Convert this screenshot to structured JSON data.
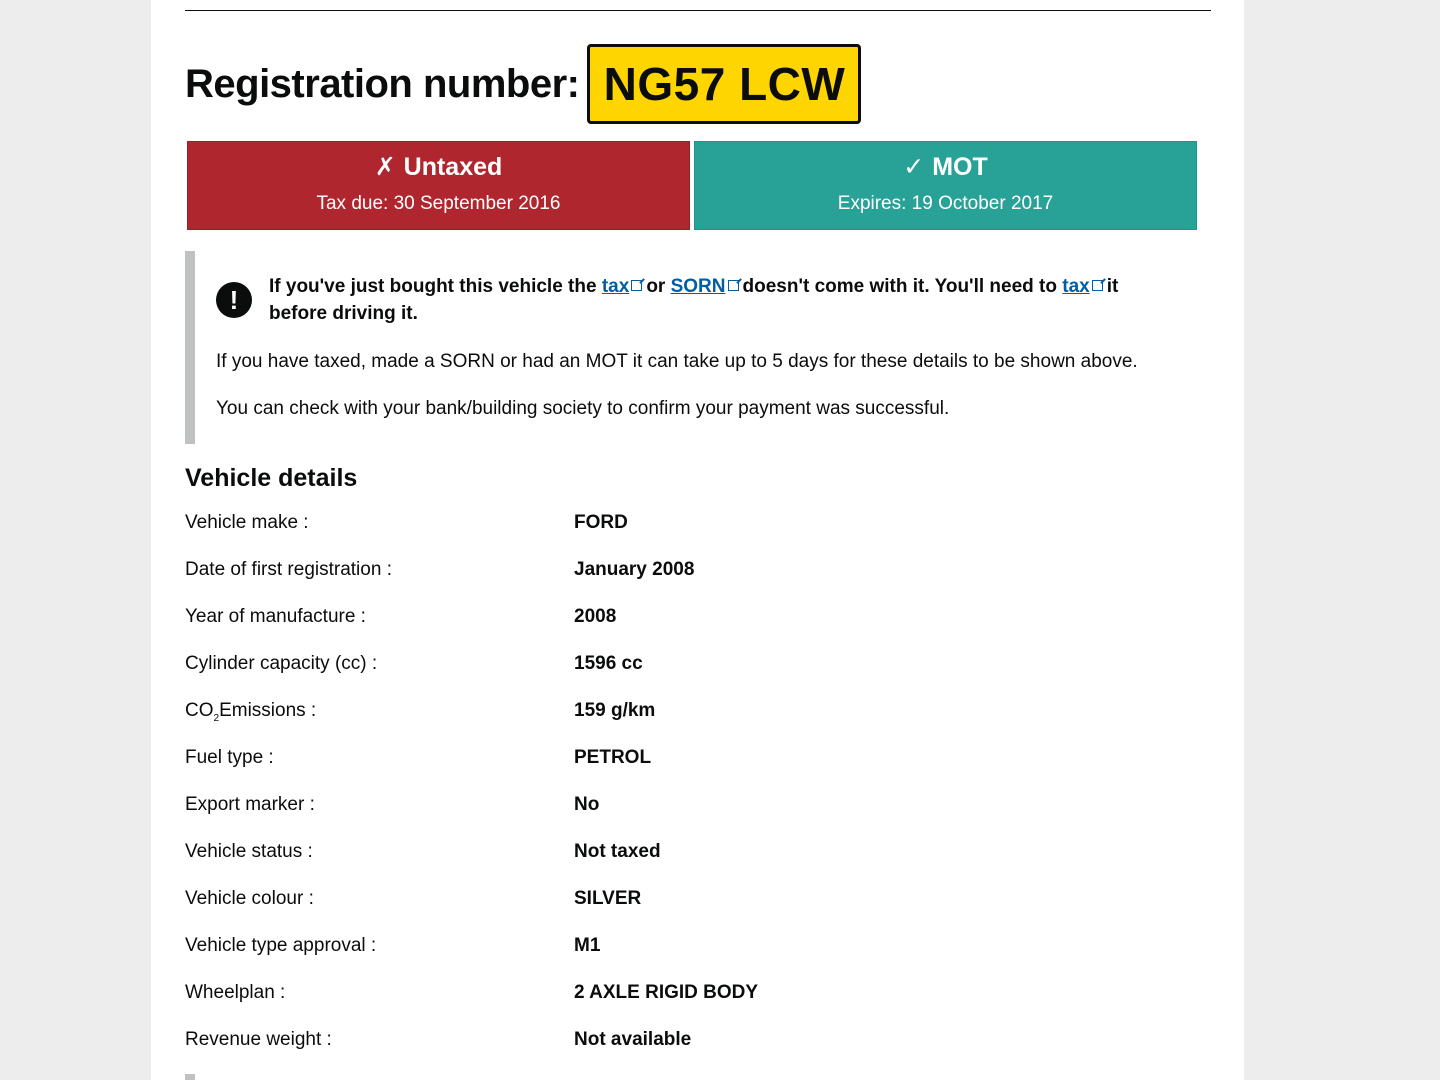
{
  "registration": {
    "label": "Registration number:",
    "plate": "NG57 LCW"
  },
  "tax_status": {
    "mark": "✗",
    "title": "Untaxed",
    "subtitle": "Tax due: 30 September 2016",
    "color": "#b0262e"
  },
  "mot_status": {
    "mark": "✓",
    "title": "MOT",
    "subtitle": "Expires: 19 October 2017",
    "color": "#28a197"
  },
  "notice": {
    "icon": "warning-exclamation-icon",
    "warning_part1": "If you've just bought this vehicle the",
    "link_tax_1": "tax",
    "warning_or": "or",
    "link_sorn": "SORN",
    "warning_part2": "doesn't come with it. You'll need to",
    "link_tax_2": "tax",
    "warning_part3": "it before driving it.",
    "paragraph1": "If you have taxed, made a SORN or had an MOT it can take up to 5 days for these details to be shown above.",
    "paragraph2": "You can check with your bank/building society to confirm your payment was successful."
  },
  "vehicle_details": {
    "heading": "Vehicle details",
    "rows": [
      {
        "label": "Vehicle make :",
        "value": "FORD"
      },
      {
        "label": "Date of first registration :",
        "value": "January 2008"
      },
      {
        "label": "Year of manufacture :",
        "value": "2008"
      },
      {
        "label": "Cylinder capacity (cc) :",
        "value": "1596 cc"
      },
      {
        "label_prefix": "CO",
        "label_sub": "2",
        "label_suffix": "Emissions :",
        "value": "159 g/km"
      },
      {
        "label": "Fuel type :",
        "value": "PETROL"
      },
      {
        "label": "Export marker :",
        "value": "No"
      },
      {
        "label": "Vehicle status :",
        "value": "Not taxed"
      },
      {
        "label": "Vehicle colour :",
        "value": "SILVER"
      },
      {
        "label": "Vehicle type approval :",
        "value": "M1"
      },
      {
        "label": "Wheelplan :",
        "value": "2 AXLE RIGID BODY"
      },
      {
        "label": "Revenue weight :",
        "value": "Not available"
      }
    ]
  },
  "colors": {
    "plate_yellow": "#ffd500",
    "link_blue": "#005ea5",
    "notice_border": "#bfc1c3"
  }
}
